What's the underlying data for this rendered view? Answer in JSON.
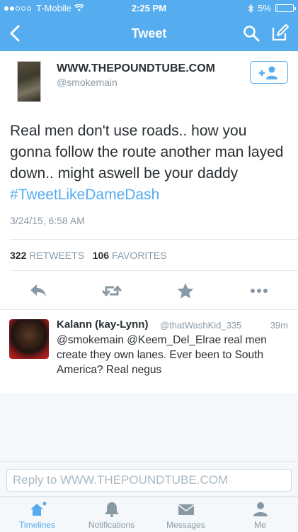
{
  "status_bar": {
    "carrier": "T-Mobile",
    "time": "2:25 PM",
    "battery": "5%",
    "battery_level": 0.05
  },
  "nav": {
    "title": "Tweet"
  },
  "tweet": {
    "author_name": "WWW.THEPOUNDTUBE.COM",
    "author_handle": "@smokemain",
    "text": "Real men don't use roads.. how you gonna follow the route another man layed down.. might aswell be your daddy ",
    "hashtag": "#TweetLikeDameDash",
    "timestamp": "3/24/15, 6:58 AM",
    "retweets_count": "322",
    "retweets_label": "RETWEETS",
    "favorites_count": "106",
    "favorites_label": "FAVORITES"
  },
  "reply": {
    "name": "Kalann (kay-Lynn)",
    "handle": "@thatWashKid_335",
    "age": "39m",
    "text": "@smokemain @Keem_Del_Elrae real men create they own lanes. Ever been to South America? Real negus"
  },
  "reply_box": {
    "placeholder": "Reply to WWW.THEPOUNDTUBE.COM"
  },
  "tabs": [
    {
      "label": "Timelines",
      "icon": "home-icon"
    },
    {
      "label": "Notifications",
      "icon": "bell-icon"
    },
    {
      "label": "Messages",
      "icon": "envelope-icon"
    },
    {
      "label": "Me",
      "icon": "person-icon"
    }
  ],
  "colors": {
    "brand": "#55acee",
    "text": "#292f33",
    "muted": "#8899a6"
  }
}
